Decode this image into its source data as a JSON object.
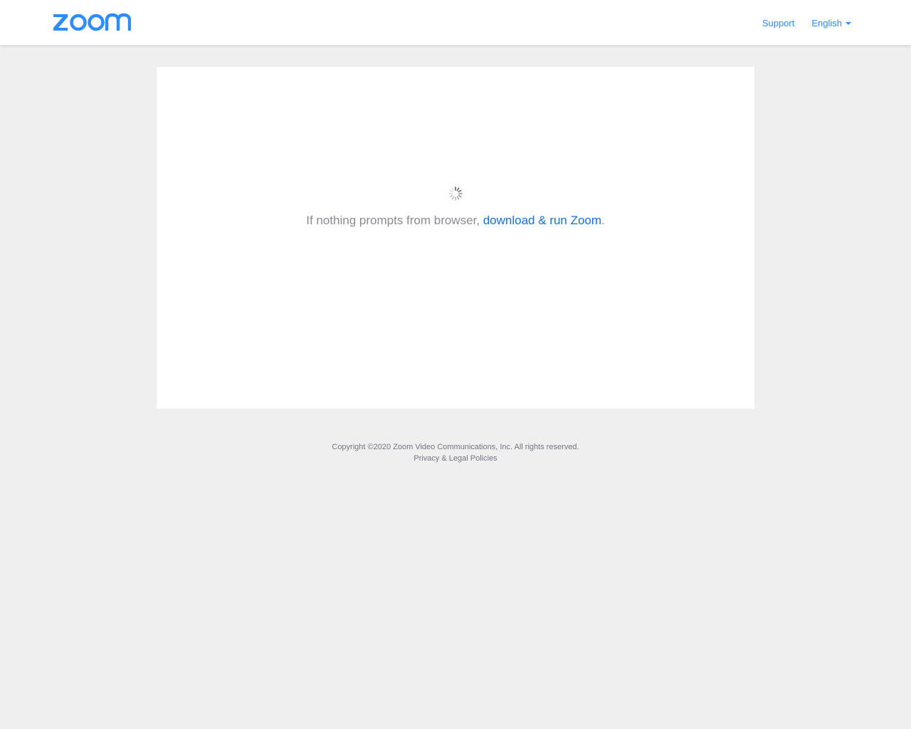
{
  "header": {
    "logo_icon": "zoom-logo",
    "brand_color": "#2d8cff",
    "nav": {
      "support_label": "Support",
      "language_label": "English",
      "language_icon": "caret-down-icon"
    }
  },
  "main": {
    "spinner_icon": "loading-spinner-icon",
    "prompt_text": "If nothing prompts from browser, ",
    "download_link_label": "download & run Zoom",
    "prompt_suffix": "."
  },
  "footer": {
    "copyright": "Copyright ©2020 Zoom Video Communications, Inc. All rights reserved.",
    "privacy_link_label": "Privacy & Legal Policies"
  },
  "colors": {
    "background": "#efefef",
    "link": "#0e72ed",
    "prompt_text": "#8b8b96"
  }
}
